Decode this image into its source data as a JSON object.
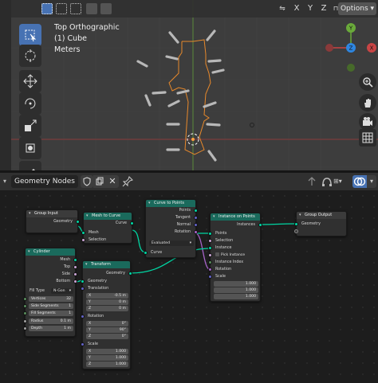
{
  "viewport": {
    "header": {
      "axis_x": "X",
      "axis_y": "Y",
      "axis_z": "Z",
      "options_label": "Options"
    },
    "info": {
      "view_name": "Top Orthographic",
      "object_name": "(1) Cube",
      "units": "Meters"
    },
    "gizmo": {
      "top": "Y",
      "left": "X",
      "right": "X",
      "center": "Z",
      "bottom": "Y"
    },
    "colors": {
      "edge": "#e8892b",
      "selected_vertex": "#ffa040",
      "grid": "#454545"
    }
  },
  "node_editor": {
    "tree_name": "Geometry Nodes",
    "nodes": {
      "group_input": {
        "title": "Group Input",
        "geometry": "Geometry"
      },
      "mesh_to_curve": {
        "title": "Mesh to Curve",
        "curve": "Curve",
        "mesh": "Mesh",
        "selection": "Selection"
      },
      "curve_to_points": {
        "title": "Curve to Points",
        "points": "Points",
        "tangent": "Tangent",
        "normal": "Normal",
        "rotation": "Rotation",
        "mode": "Evaluated",
        "curve": "Curve"
      },
      "instance_on_points": {
        "title": "Instance on Points",
        "instances": "Instances",
        "points": "Points",
        "selection": "Selection",
        "instance": "Instance",
        "pick_instance": "Pick Instance",
        "instance_index": "Instance Index",
        "rotation": "Rotation",
        "scale": "Scale",
        "scale_x": "1.000",
        "scale_y": "1.000",
        "scale_z": "1.000"
      },
      "group_output": {
        "title": "Group Output",
        "geometry": "Geometry"
      },
      "cylinder": {
        "title": "Cylinder",
        "mesh": "Mesh",
        "top": "Top",
        "side": "Side",
        "bottom": "Bottom",
        "fill_type_label": "Fill Type",
        "fill_type_value": "N-Gon",
        "vertices_label": "Vertices",
        "vertices_value": "32",
        "side_segments_label": "Side Segments",
        "side_segments_value": "1",
        "fill_segments_label": "Fill Segments",
        "fill_segments_value": "1",
        "radius_label": "Radius",
        "radius_value": "0.1 m",
        "depth_label": "Depth",
        "depth_value": "1 m"
      },
      "transform": {
        "title": "Transform",
        "geometry_out": "Geometry",
        "geometry_in": "Geometry",
        "translation": "Translation",
        "tx": "-0.5 m",
        "ty": "0 m",
        "tz": "0 m",
        "rotation": "Rotation",
        "rx": "0°",
        "ry": "90°",
        "rz": "0°",
        "scale": "Scale",
        "sx": "1.000",
        "sy": "1.000",
        "sz": "1.000",
        "x": "X",
        "y": "Y",
        "z": "Z"
      }
    }
  }
}
